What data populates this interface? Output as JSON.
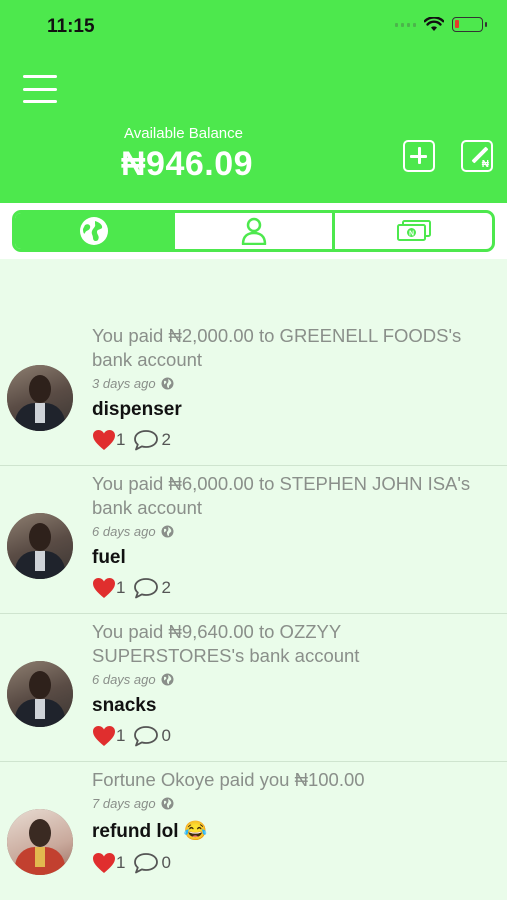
{
  "status_bar": {
    "time": "11:15"
  },
  "header": {
    "balance_label": "Available Balance",
    "balance_amount": "₦946.09",
    "colors": {
      "brand": "#4de84d",
      "background": "#eafcea"
    }
  },
  "tabs": [
    {
      "icon": "globe-icon",
      "active": true
    },
    {
      "icon": "person-icon",
      "active": false
    },
    {
      "icon": "cash-icon",
      "active": false
    }
  ],
  "feed": [
    {
      "description": "You paid ₦2,000.00 to GREENELL FOODS's bank account",
      "time": "3 days ago",
      "note": "dispenser",
      "likes": "1",
      "comments": "2"
    },
    {
      "description": "You paid ₦6,000.00 to STEPHEN JOHN ISA's bank account",
      "time": "6 days ago",
      "note": "fuel",
      "likes": "1",
      "comments": "2"
    },
    {
      "description": "You paid ₦9,640.00 to OZZYY SUPERSTORES's bank account",
      "time": "6 days ago",
      "note": "snacks",
      "likes": "1",
      "comments": "0"
    },
    {
      "description": "Fortune Okoye paid you ₦100.00",
      "time": "7 days ago",
      "note": "refund lol 😂",
      "likes": "1",
      "comments": "0"
    }
  ]
}
